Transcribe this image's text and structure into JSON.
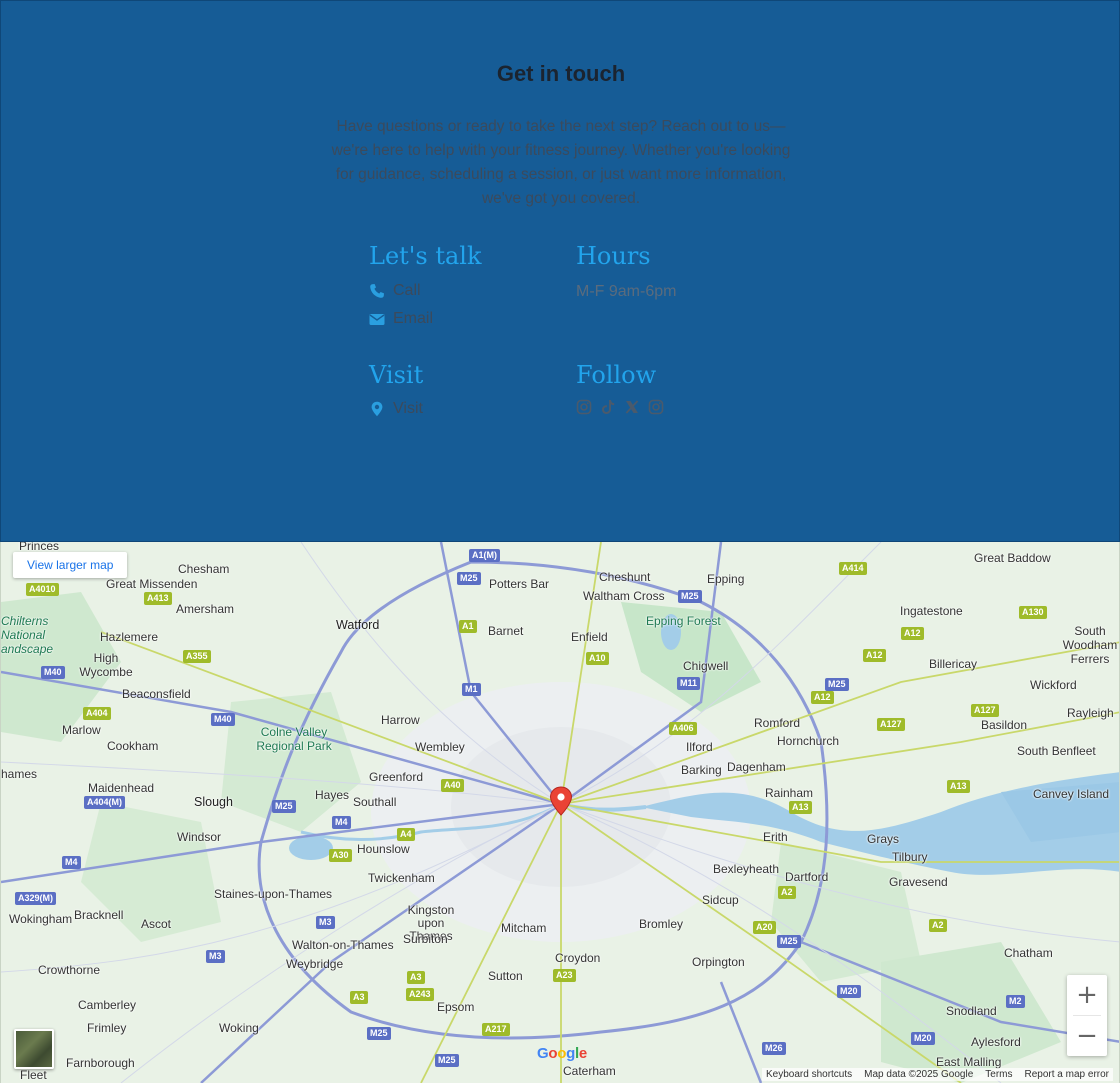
{
  "contact": {
    "heading": "Get in touch",
    "intro": "Have questions or ready to take the next step? Reach out to us—we're here to help with your fitness journey. Whether you're looking for guidance, scheduling a session, or just want more information, we've got you covered.",
    "talk": {
      "heading": "Let's talk",
      "call_label": "Call",
      "email_label": "Email",
      "call_icon": "phone-icon",
      "email_icon": "envelope-icon"
    },
    "hours": {
      "heading": "Hours",
      "text": "M-F 9am-6pm"
    },
    "visit": {
      "heading": "Visit",
      "label": "Visit",
      "icon": "map-marker-icon"
    },
    "follow": {
      "heading": "Follow",
      "icons": [
        "instagram-icon",
        "tiktok-icon",
        "x-icon",
        "instagram-icon"
      ]
    },
    "colors": {
      "background": "#165c96",
      "accent": "#22a4ec"
    }
  },
  "map": {
    "larger_map_label": "View larger map",
    "zoom_in": "+",
    "zoom_out": "−",
    "attribution": {
      "shortcuts": "Keyboard shortcuts",
      "data": "Map data ©2025 Google",
      "terms": "Terms",
      "report": "Report a map error"
    },
    "places": [
      "Princes",
      "Great Missenden",
      "Chesham",
      "Potters Bar",
      "Cheshunt",
      "Epping",
      "Great Baddow",
      "Amersham",
      "Watford",
      "Barnet",
      "Enfield",
      "Waltham Cross",
      "Epping Forest",
      "Ingatestone",
      "Chilterns National andscape",
      "Hazlemere",
      "High Wycombe",
      "Chigwell",
      "Billericay",
      "South Woodham Ferrers",
      "Beaconsfield",
      "Harrow",
      "Wickford",
      "Rayleigh",
      "Marlow",
      "Cookham",
      "Colne Valley Regional Park",
      "Wembley",
      "Romford",
      "Hornchurch",
      "Basildon",
      "Ilford",
      "South Benfleet",
      "Barking",
      "Dagenham",
      "hames",
      "Maidenhead",
      "Greenford",
      "Rainham",
      "Canvey Island",
      "Slough",
      "Hayes",
      "Southall",
      "Windsor",
      "Hounslow",
      "Erith",
      "Grays",
      "Tilbury",
      "Dartford",
      "Bexleyheath",
      "Gravesend",
      "Twickenham",
      "Staines-upon-Thames",
      "Wokingham",
      "Bracknell",
      "Ascot",
      "Kingston upon Thames",
      "Surbiton",
      "Sidcup",
      "Mitcham",
      "Bromley",
      "Walton-on-Thames",
      "Weybridge",
      "Croydon",
      "Orpington",
      "Chatham",
      "Crowthorne",
      "Sutton",
      "Epsom",
      "Camberley",
      "Frimley",
      "Woking",
      "Farnborough",
      "Caterham",
      "Snodland",
      "Aylesford",
      "East Malling",
      "Fleet"
    ],
    "roads": [
      "A1(M)",
      "A4010",
      "A413",
      "M25",
      "A414",
      "A1",
      "A10",
      "M25",
      "A12",
      "A130",
      "A355",
      "M1",
      "M11",
      "A12",
      "M40",
      "A404",
      "M40",
      "A406",
      "A12",
      "M25",
      "A127",
      "A127",
      "A40",
      "A13",
      "A13",
      "A404(M)",
      "M25",
      "M4",
      "A4",
      "A30",
      "M4",
      "A2",
      "A329(M)",
      "M3",
      "A20",
      "A2",
      "M3",
      "A3",
      "A243",
      "A3",
      "A23",
      "M20",
      "M2",
      "A217",
      "M25",
      "M25",
      "M26",
      "M20",
      "M25"
    ]
  }
}
